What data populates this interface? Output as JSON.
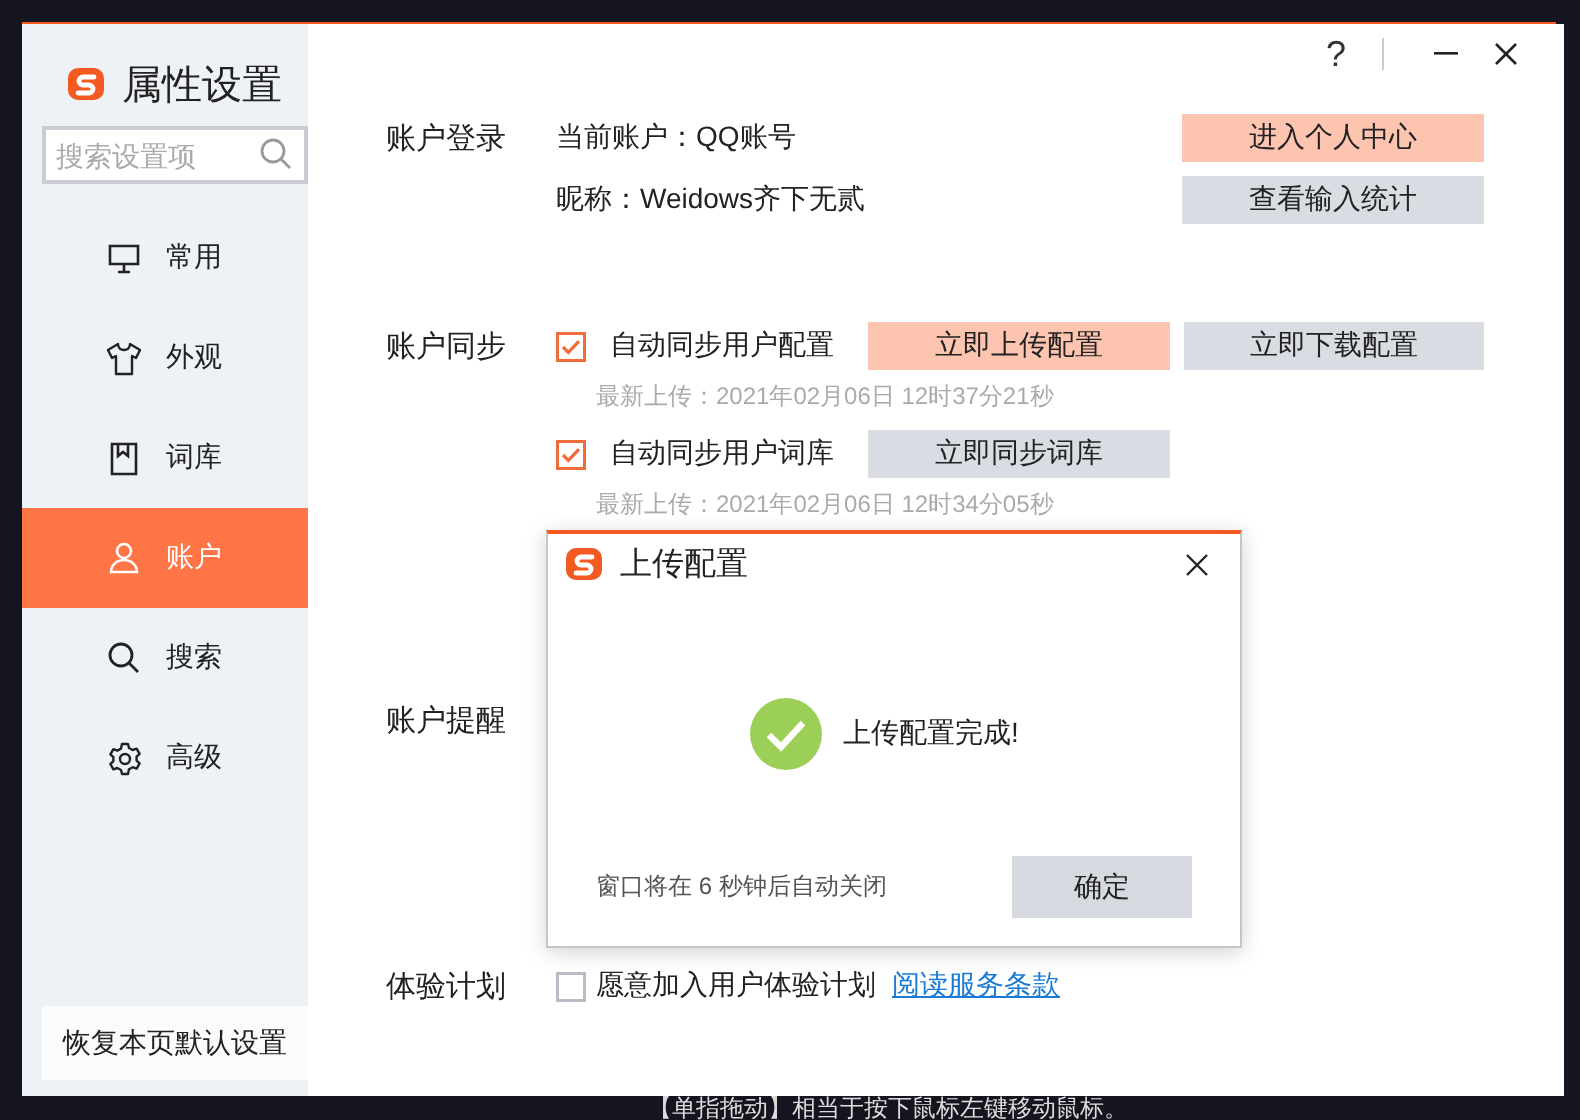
{
  "window": {
    "title": "属性设置",
    "help": "?"
  },
  "sidebar": {
    "search_placeholder": "搜索设置项",
    "items": [
      {
        "label": "常用",
        "selected": false
      },
      {
        "label": "外观",
        "selected": false
      },
      {
        "label": "词库",
        "selected": false
      },
      {
        "label": "账户",
        "selected": true
      },
      {
        "label": "搜索",
        "selected": false
      },
      {
        "label": "高级",
        "selected": false
      }
    ],
    "restore_button": "恢复本页默认设置"
  },
  "account_login": {
    "label": "账户登录",
    "current_account": "当前账户：QQ账号",
    "nickname": "昵称：Weidows齐下无贰",
    "buttons": [
      {
        "label": "进入个人中心",
        "primary": true
      },
      {
        "label": "查看输入统计",
        "primary": false
      }
    ]
  },
  "account_sync": {
    "label": "账户同步",
    "options": [
      {
        "label": "自动同步用户配置",
        "checked": true,
        "buttons": [
          {
            "label": "立即上传配置",
            "primary": true
          },
          {
            "label": "立即下载配置",
            "primary": false
          }
        ],
        "last_upload": "最新上传：2021年02月06日 12时37分21秒"
      },
      {
        "label": "自动同步用户词库",
        "checked": true,
        "buttons": [
          {
            "label": "立即同步词库",
            "primary": false
          }
        ],
        "last_upload": "最新上传：2021年02月06日 12时34分05秒"
      }
    ]
  },
  "account_reminder": {
    "label": "账户提醒"
  },
  "experience": {
    "label": "体验计划",
    "option": {
      "label": "愿意加入用户体验计划",
      "checked": false
    },
    "link": "阅读服务条款"
  },
  "dialog": {
    "title": "上传配置",
    "message": "上传配置完成!",
    "countdown": "窗口将在 6 秒钟后自动关闭",
    "button": "确定"
  },
  "background": {
    "caption": "【单指拖动】相当于按下鼠标左键移动鼠标。"
  }
}
